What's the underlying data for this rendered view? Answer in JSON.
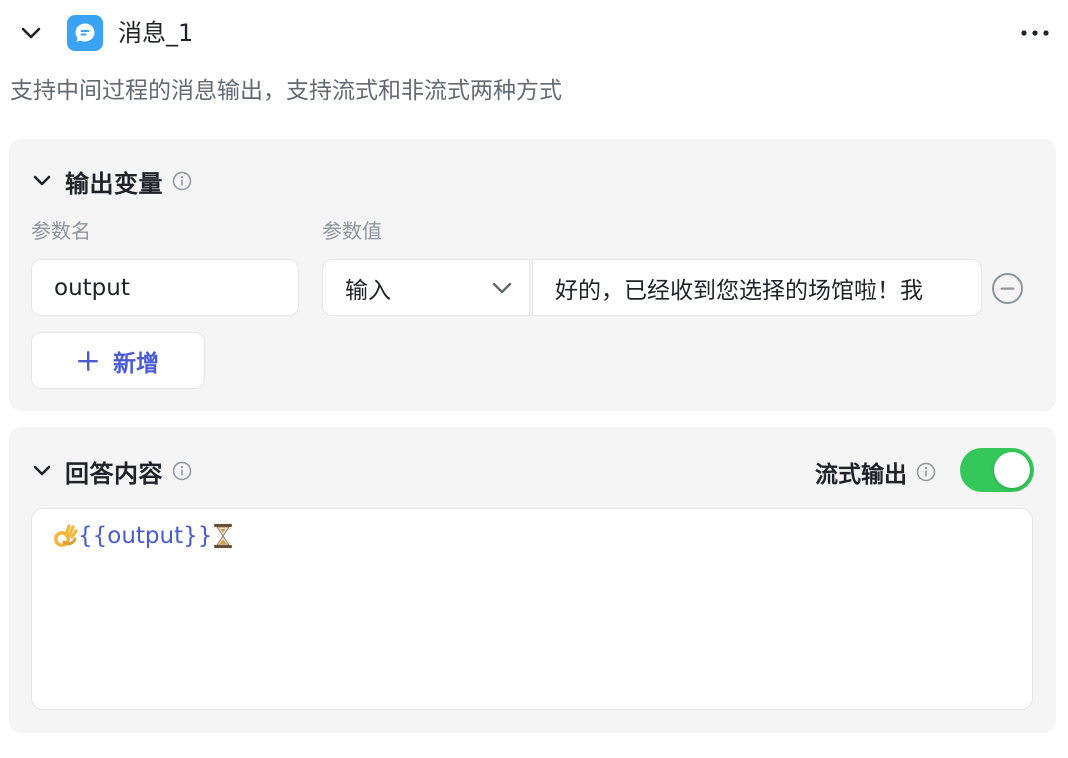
{
  "node": {
    "title": "消息_1",
    "description": "支持中间过程的消息输出，支持流式和非流式两种方式",
    "icon": "message-bubble-icon",
    "icon_color": "#3aa3f4"
  },
  "output_section": {
    "title": "输出变量",
    "col_name_label": "参数名",
    "col_value_label": "参数值",
    "rows": [
      {
        "name": "output",
        "value_type": "输入",
        "value": "好的，已经收到您选择的场馆啦！我"
      }
    ],
    "add_label": "新增"
  },
  "answer_section": {
    "title": "回答内容",
    "stream_label": "流式输出",
    "stream_enabled": true,
    "content_prefix_emoji": "ok-hand-emoji",
    "content_variable": "{{output}}",
    "content_suffix_emoji": "hourglass-emoji"
  },
  "colors": {
    "accent": "#4a5bd4",
    "toggle_on": "#34c759",
    "panel_bg": "#f5f5f6"
  }
}
